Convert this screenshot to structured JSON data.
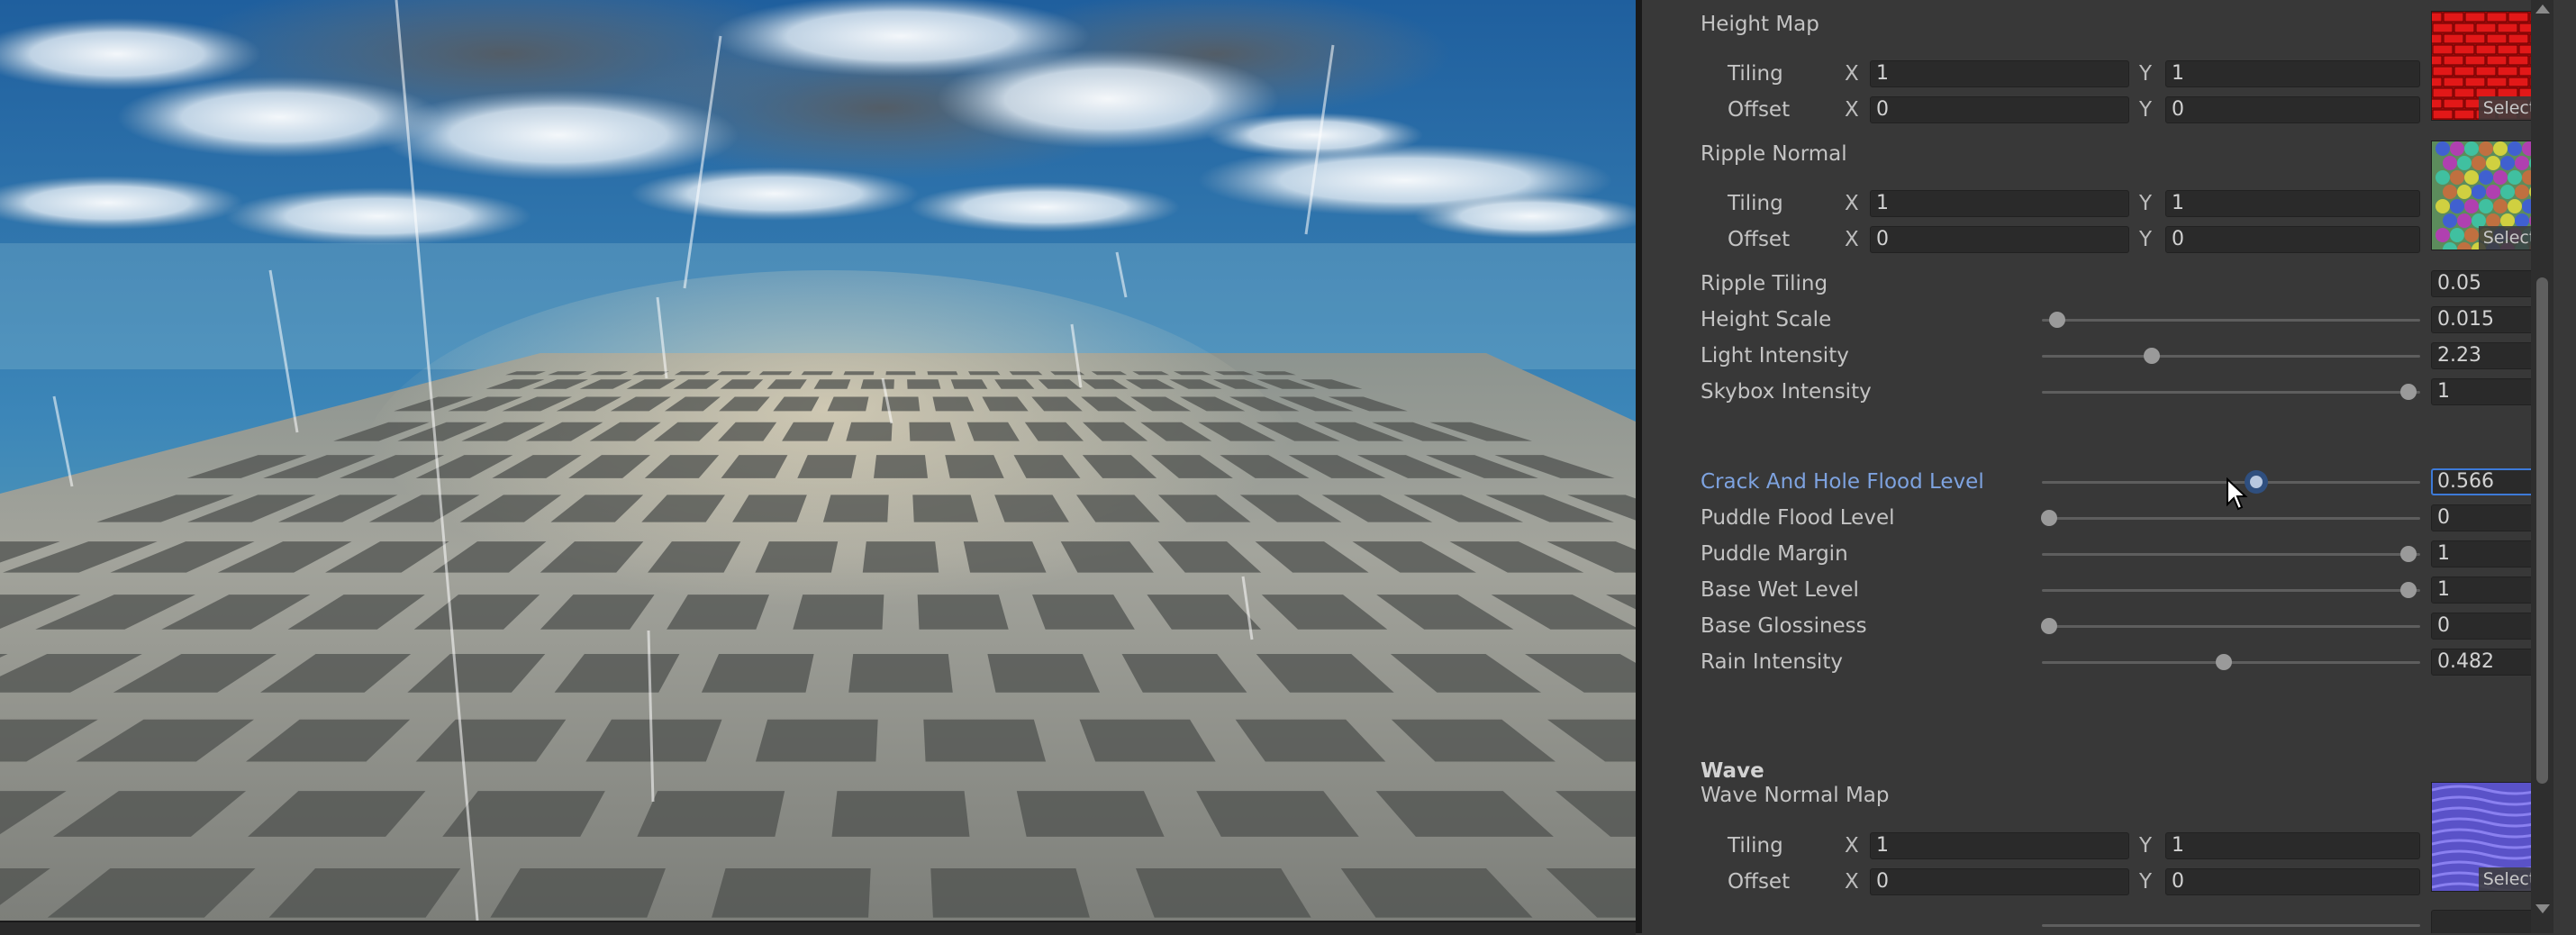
{
  "inspector": {
    "height_map": {
      "label": "Height Map",
      "tiling": {
        "label": "Tiling",
        "x_axis": "X",
        "x": "1",
        "y_axis": "Y",
        "y": "1"
      },
      "offset": {
        "label": "Offset",
        "x_axis": "X",
        "x": "0",
        "y_axis": "Y",
        "y": "0"
      },
      "select_label": "Select"
    },
    "ripple_normal": {
      "label": "Ripple Normal",
      "tiling": {
        "label": "Tiling",
        "x_axis": "X",
        "x": "1",
        "y_axis": "Y",
        "y": "1"
      },
      "offset": {
        "label": "Offset",
        "x_axis": "X",
        "x": "0",
        "y_axis": "Y",
        "y": "0"
      },
      "select_label": "Select"
    },
    "ripple_tiling": {
      "label": "Ripple Tiling",
      "value": "0.05"
    },
    "sliders_group1": [
      {
        "label": "Height Scale",
        "value": "0.015",
        "level": 0.04
      },
      {
        "label": "Light Intensity",
        "value": "2.23",
        "level": 0.29
      },
      {
        "label": "Skybox Intensity",
        "value": "1",
        "level": 0.97
      }
    ],
    "sliders_group2": [
      {
        "label": "Crack And Hole Flood Level",
        "value": "0.566",
        "level": 0.566
      },
      {
        "label": "Puddle Flood Level",
        "value": "0",
        "level": 0.02
      },
      {
        "label": "Puddle Margin",
        "value": "1",
        "level": 0.97
      },
      {
        "label": "Base Wet Level",
        "value": "1",
        "level": 0.97
      },
      {
        "label": "Base Glossiness",
        "value": "0",
        "level": 0.02
      },
      {
        "label": "Rain Intensity",
        "value": "0.482",
        "level": 0.482
      }
    ],
    "wave": {
      "header": "Wave",
      "normal_map": {
        "label": "Wave Normal Map",
        "tiling": {
          "label": "Tiling",
          "x_axis": "X",
          "x": "1",
          "y_axis": "Y",
          "y": "1"
        },
        "offset": {
          "label": "Offset",
          "x_axis": "X",
          "x": "0",
          "y_axis": "Y",
          "y": "0"
        },
        "select_label": "Select"
      }
    }
  },
  "colors": {
    "active_label": "#7ea3e0",
    "focus_border": "#3d7ad8",
    "height_map_thumb": "#c01010",
    "ripple_thumb": "#6a9a6a",
    "wave_thumb": "#5a52c8"
  }
}
